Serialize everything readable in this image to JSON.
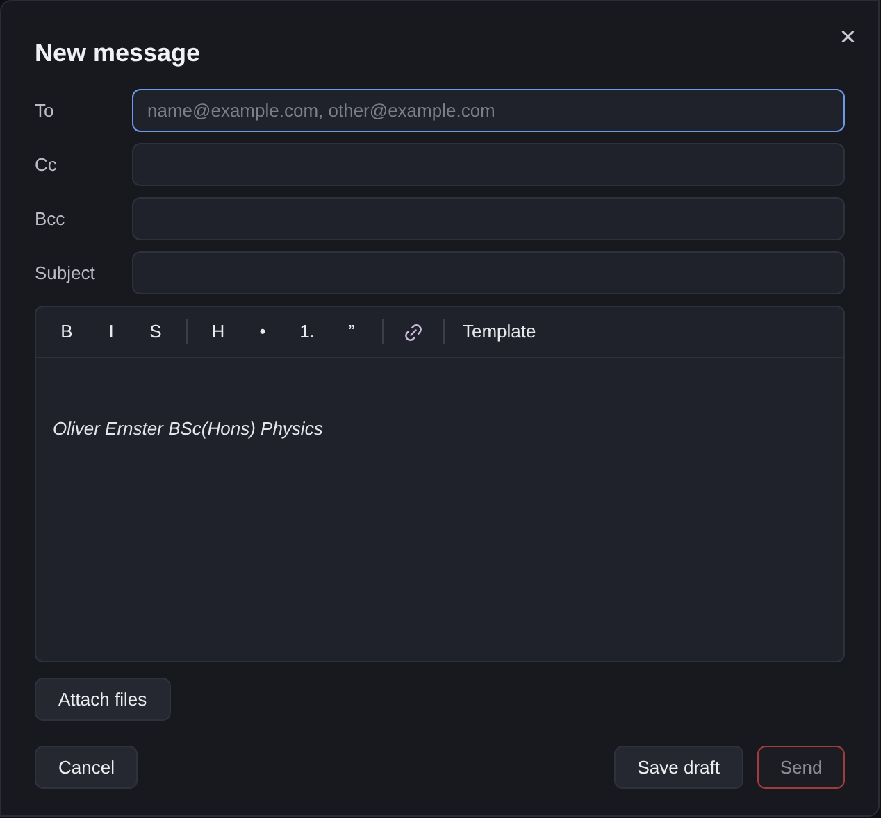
{
  "dialog": {
    "title": "New message",
    "close": "×"
  },
  "fields": [
    {
      "label": "To",
      "placeholder": "name@example.com, other@example.com",
      "focused": true
    },
    {
      "label": "Cc",
      "focused": false
    },
    {
      "label": "Bcc",
      "focused": false
    },
    {
      "label": "Subject",
      "focused": false
    }
  ],
  "toolbar": [
    {
      "kind": "button",
      "label": "B"
    },
    {
      "kind": "button",
      "label": "I"
    },
    {
      "kind": "button",
      "label": "S"
    },
    {
      "kind": "divider"
    },
    {
      "kind": "button",
      "label": "H"
    },
    {
      "kind": "button",
      "label": "•"
    },
    {
      "kind": "button",
      "label": "1."
    },
    {
      "kind": "button",
      "label": "”"
    },
    {
      "kind": "divider"
    },
    {
      "kind": "link"
    },
    {
      "kind": "divider"
    },
    {
      "kind": "button",
      "label": "Template"
    }
  ],
  "body": {
    "signature": "Oliver Ernster BSc(Hons) Physics"
  },
  "attach_button": "Attach files",
  "footer": {
    "cancel": "Cancel",
    "save_draft": "Save draft",
    "send": {
      "label": "Send",
      "disabled": true
    }
  }
}
